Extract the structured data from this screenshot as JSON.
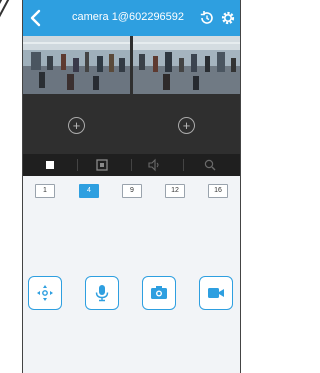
{
  "header": {
    "title": "camera 1@602296592"
  },
  "splits": [
    "1",
    "4",
    "9",
    "12",
    "16"
  ],
  "active_split": "4",
  "colors": {
    "accent": "#2e9fe0",
    "toolbar": "#1f1f1f",
    "grid": "#2f2f2f",
    "background": "#f2f4f7"
  }
}
